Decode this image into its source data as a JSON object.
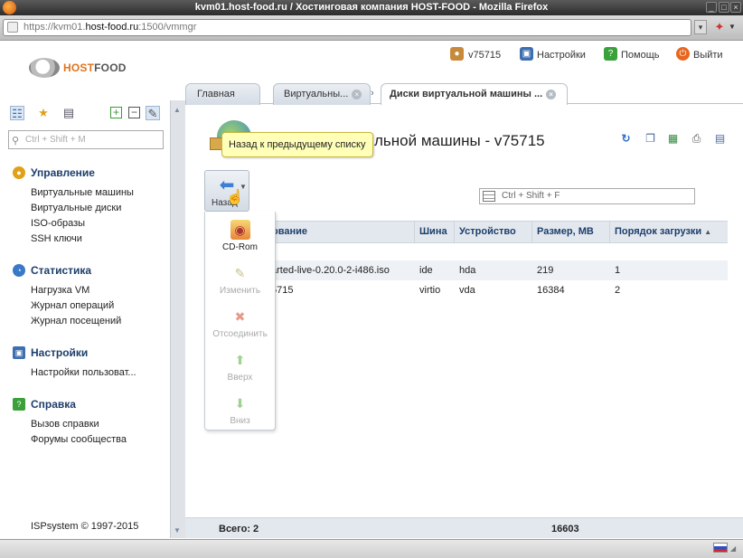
{
  "window": {
    "title": "kvm01.host-food.ru / Хостинговая компания HOST-FOOD - Mozilla Firefox"
  },
  "browser": {
    "url_prefix": "https://kvm01.",
    "url_domain": "host-food.ru",
    "url_suffix": ":1500/vmmgr"
  },
  "header": {
    "logo_host": "HOST",
    "logo_food": "FOOD",
    "user": "v75715",
    "settings": "Настройки",
    "help": "Помощь",
    "logout": "Выйти"
  },
  "tabs": [
    {
      "label": "Главная"
    },
    {
      "label": "Виртуальны..."
    },
    {
      "label": "Диски виртуальной машины ..."
    }
  ],
  "sidebar": {
    "search_placeholder": "Ctrl + Shift + M",
    "sections": [
      {
        "title": "Управление",
        "items": [
          "Виртуальные машины",
          "Виртуальные диски",
          "ISO-образы",
          "SSH ключи"
        ]
      },
      {
        "title": "Статистика",
        "items": [
          "Нагрузка VM",
          "Журнал операций",
          "Журнал посещений"
        ]
      },
      {
        "title": "Настройки",
        "items": [
          "Настройки пользоват..."
        ]
      },
      {
        "title": "Справка",
        "items": [
          "Вызов справки",
          "Форумы сообщества"
        ]
      }
    ],
    "copyright": "ISPsystem © 1997-2015"
  },
  "main": {
    "title": "льной машины - v75715",
    "tooltip": "Назад к предыдущему списку",
    "filter_placeholder": "Ctrl + Shift + F",
    "back_label": "Назад"
  },
  "dropdown": [
    {
      "label": "CD-Rom",
      "icon": "cdrom-icon",
      "enabled": true
    },
    {
      "label": "Изменить",
      "icon": "edit-icon",
      "enabled": false
    },
    {
      "label": "Отсоединить",
      "icon": "detach-icon",
      "enabled": false
    },
    {
      "label": "Вверх",
      "icon": "up-icon",
      "enabled": false
    },
    {
      "label": "Вниз",
      "icon": "down-icon",
      "enabled": false
    }
  ],
  "table": {
    "columns": [
      "ование",
      "Шина",
      "Устройство",
      "Размер, MB",
      "Порядок загрузки"
    ],
    "rows": [
      [
        "arted-live-0.20.0-2-i486.iso",
        "ide",
        "hda",
        "219",
        "1"
      ],
      [
        "5715",
        "virtio",
        "vda",
        "16384",
        "2"
      ]
    ],
    "total_label": "Всего: 2",
    "total_size": "16603"
  },
  "colors": {
    "accent": "#1c3e6b",
    "logo_orange": "#e0731b",
    "tooltip_bg": "#ffffb8"
  }
}
